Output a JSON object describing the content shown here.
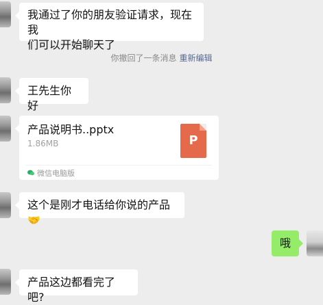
{
  "messages": [
    {
      "from": "other",
      "text": "我通过了你的朋友验证请求，现在我们可以开始聊天了"
    },
    {
      "type": "system",
      "text": "你撤回了一条消息",
      "action": "重新编辑"
    },
    {
      "from": "other",
      "text": "王先生你好"
    },
    {
      "from": "other",
      "type": "file",
      "file": {
        "name": "产品说明书..pptx",
        "size": "1.86MB",
        "icon_letter": "P",
        "icon_color": "#e5694b",
        "source": "微信电脑版"
      }
    },
    {
      "from": "other",
      "text": "这个是刚才电话给你说的产品",
      "emoji": "🤝"
    },
    {
      "from": "me",
      "text": "哦"
    },
    {
      "from": "other",
      "text": "产品这边都看完了吧?"
    }
  ],
  "msg1": {
    "line1": "我通过了你的朋友验证请求，现在我",
    "line2": "们可以开始聊天了"
  },
  "colors": {
    "background": "#ededed",
    "my_bubble": "#95ec69",
    "link": "#576b95"
  }
}
